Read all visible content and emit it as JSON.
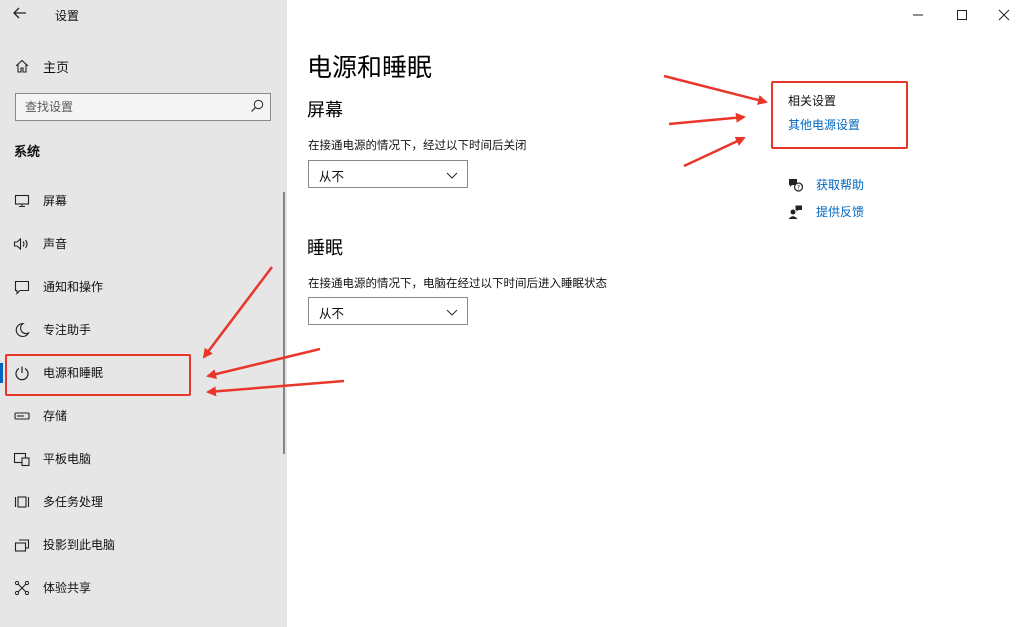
{
  "window": {
    "title": "设置",
    "controls": {
      "minimize": "minimize-icon",
      "maximize": "maximize-icon",
      "close": "close-icon"
    }
  },
  "sidebar": {
    "home_label": "主页",
    "search_placeholder": "查找设置",
    "section": "系统",
    "items": [
      {
        "label": "屏幕",
        "icon": "monitor-icon"
      },
      {
        "label": "声音",
        "icon": "speaker-icon"
      },
      {
        "label": "通知和操作",
        "icon": "notification-icon"
      },
      {
        "label": "专注助手",
        "icon": "moon-icon"
      },
      {
        "label": "电源和睡眠",
        "icon": "power-icon",
        "active": true
      },
      {
        "label": "存储",
        "icon": "storage-icon"
      },
      {
        "label": "平板电脑",
        "icon": "tablet-icon"
      },
      {
        "label": "多任务处理",
        "icon": "multitask-icon"
      },
      {
        "label": "投影到此电脑",
        "icon": "project-icon"
      },
      {
        "label": "体验共享",
        "icon": "share-icon"
      }
    ]
  },
  "main": {
    "title": "电源和睡眠",
    "screen": {
      "heading": "屏幕",
      "description": "在接通电源的情况下，经过以下时间后关闭",
      "value": "从不"
    },
    "sleep": {
      "heading": "睡眠",
      "description": "在接通电源的情况下，电脑在经过以下时间后进入睡眠状态",
      "value": "从不"
    }
  },
  "related": {
    "title": "相关设置",
    "link": "其他电源设置"
  },
  "help": {
    "get_help": "获取帮助",
    "feedback": "提供反馈"
  },
  "colors": {
    "accent": "#0067c0",
    "annotation": "#e8362b",
    "sidebar_bg": "#e6e6e6"
  }
}
